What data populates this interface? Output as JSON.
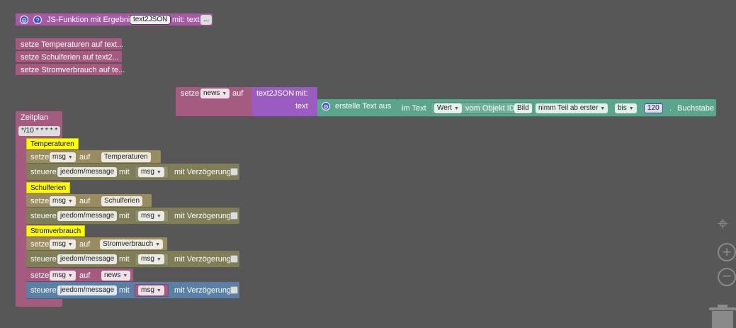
{
  "colors": {
    "background": "#575757",
    "function_block": "#a55aa4",
    "variable_block": "#a55b80",
    "text_block": "#5ba58c",
    "control_block": "#7f7e58",
    "selected_block": "#5b80a5",
    "comment_label": "#ffff00"
  },
  "function_header": {
    "icons": [
      "gear-icon",
      "help-icon"
    ],
    "gear_glyph": "⚙",
    "help_glyph": "?",
    "title": "JS-Funktion mit Ergebnis",
    "name": "text2JSON",
    "param_label": "mit: text",
    "more": "..."
  },
  "collapsed_blocks": [
    "setze Temperaturen auf text...",
    "setze Schulferien auf text2...",
    "setze Stromverbrauch auf te..."
  ],
  "assignment": {
    "setze": "setze",
    "variable": "news",
    "auf": "auf",
    "func": "text2JSON",
    "mit": "mit:",
    "text_label": "text",
    "create_text": "erstelle Text aus",
    "im_text": "im Text",
    "wert": "Wert",
    "vom_objekt_id": "vom Objekt ID",
    "bild": "Bild",
    "nimm_teil": "nimm Teil ab erster",
    "bis": "bis",
    "number": "120",
    "dot": ".",
    "buchstabe": "Buchstabe"
  },
  "schedule": {
    "title": "Zeitplan",
    "cron": "*/10 * * * * *",
    "sections": [
      {
        "comment": "Temperaturen",
        "setze": "setze",
        "var": "msg",
        "auf": "auf",
        "value": "Temperaturen",
        "steuere": "steuere",
        "target": "jeedom/message",
        "mit": "mit",
        "msg": "msg",
        "delay": "mit Verzögerung"
      },
      {
        "comment": "Schulferien",
        "setze": "setze",
        "var": "msg",
        "auf": "auf",
        "value": "Schulferien",
        "steuere": "steuere",
        "target": "jeedom/message",
        "mit": "mit",
        "msg": "msg",
        "delay": "mit Verzögerung"
      },
      {
        "comment": "Stromverbrauch",
        "setze": "setze",
        "var": "msg",
        "auf": "auf",
        "value": "Stromverbrauch",
        "steuere": "steuere",
        "target": "jeedom/message",
        "mit": "mit",
        "msg": "msg",
        "delay": "mit Verzögerung"
      }
    ],
    "final_set": {
      "setze": "setze",
      "var": "msg",
      "auf": "auf",
      "value": "news"
    },
    "final_control": {
      "steuere": "steuere",
      "target": "jeedom/message",
      "mit": "mit",
      "msg": "msg",
      "delay": "mit Verzögerung"
    }
  },
  "workspace_controls": {
    "center": "⌖",
    "zoom_in": "+",
    "zoom_out": "−",
    "trash_icon": "trash-icon"
  }
}
